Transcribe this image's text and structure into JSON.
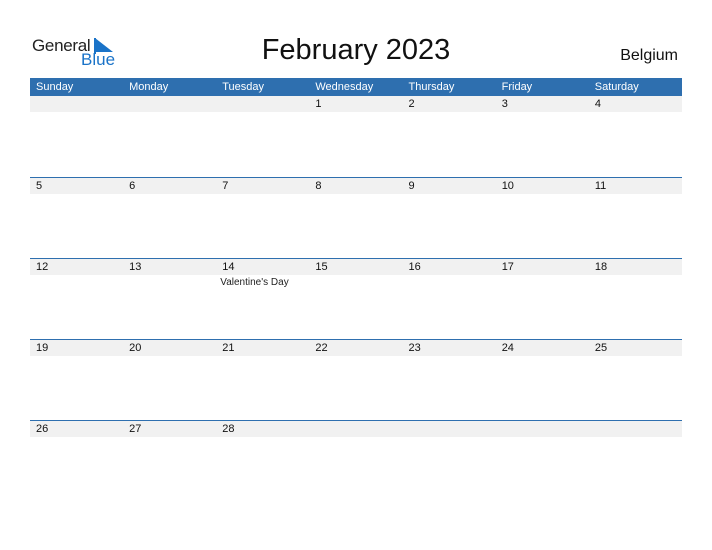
{
  "logo": {
    "word1": "General",
    "word2": "Blue"
  },
  "title": "February 2023",
  "country": "Belgium",
  "colors": {
    "accent": "#2e6faf",
    "strip": "#f1f1f1"
  },
  "weekdays": [
    "Sunday",
    "Monday",
    "Tuesday",
    "Wednesday",
    "Thursday",
    "Friday",
    "Saturday"
  ],
  "weeks": [
    [
      {
        "day": ""
      },
      {
        "day": ""
      },
      {
        "day": ""
      },
      {
        "day": "1"
      },
      {
        "day": "2"
      },
      {
        "day": "3"
      },
      {
        "day": "4"
      }
    ],
    [
      {
        "day": "5"
      },
      {
        "day": "6"
      },
      {
        "day": "7"
      },
      {
        "day": "8"
      },
      {
        "day": "9"
      },
      {
        "day": "10"
      },
      {
        "day": "11"
      }
    ],
    [
      {
        "day": "12"
      },
      {
        "day": "13"
      },
      {
        "day": "14",
        "event": "Valentine's Day"
      },
      {
        "day": "15"
      },
      {
        "day": "16"
      },
      {
        "day": "17"
      },
      {
        "day": "18"
      }
    ],
    [
      {
        "day": "19"
      },
      {
        "day": "20"
      },
      {
        "day": "21"
      },
      {
        "day": "22"
      },
      {
        "day": "23"
      },
      {
        "day": "24"
      },
      {
        "day": "25"
      }
    ],
    [
      {
        "day": "26"
      },
      {
        "day": "27"
      },
      {
        "day": "28"
      },
      {
        "day": ""
      },
      {
        "day": ""
      },
      {
        "day": ""
      },
      {
        "day": ""
      }
    ]
  ]
}
